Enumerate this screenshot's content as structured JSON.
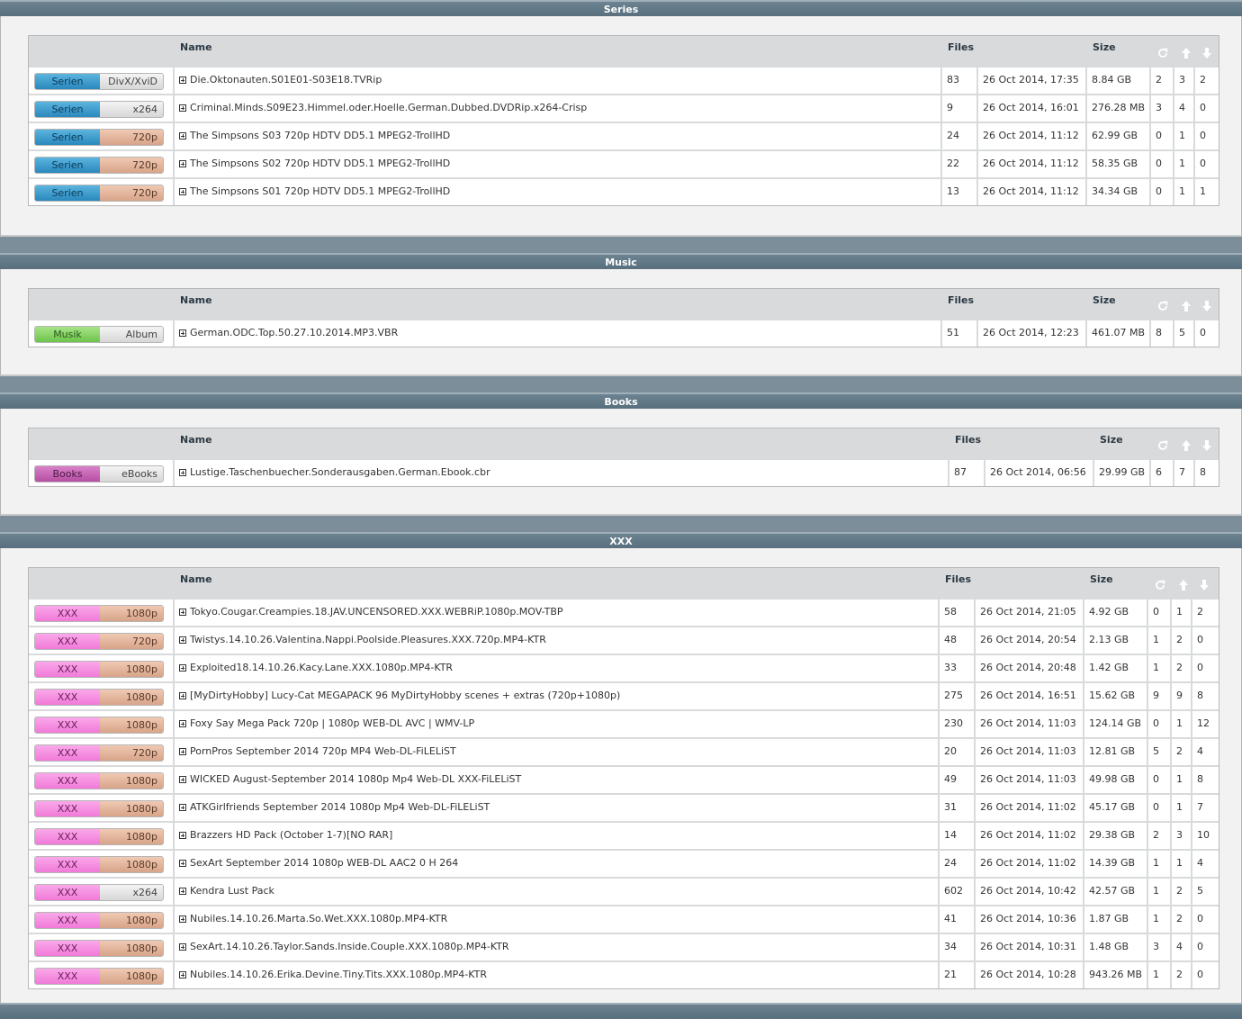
{
  "headers": {
    "name": "Name",
    "files": "Files",
    "size": "Size"
  },
  "icons": {
    "refresh": "refresh-icon",
    "up": "arrow-up-icon",
    "down": "arrow-down-icon",
    "expand": "plus-box-icon"
  },
  "sections": [
    {
      "title": "Series",
      "rows": [
        {
          "cat": "Serien",
          "sub": "DivX/XviD",
          "name": "Die.Oktonauten.S01E01-S03E18.TVRip",
          "files": "83",
          "date": "26 Oct 2014, 17:35",
          "size": "8.84 GB",
          "r": "2",
          "s": "3",
          "l": "2"
        },
        {
          "cat": "Serien",
          "sub": "x264",
          "name": "Criminal.Minds.S09E23.Himmel.oder.Hoelle.German.Dubbed.DVDRip.x264-Crisp",
          "files": "9",
          "date": "26 Oct 2014, 16:01",
          "size": "276.28 MB",
          "r": "3",
          "s": "4",
          "l": "0"
        },
        {
          "cat": "Serien",
          "sub": "720p",
          "name": "The Simpsons S03 720p HDTV DD5.1 MPEG2-TrollHD",
          "files": "24",
          "date": "26 Oct 2014, 11:12",
          "size": "62.99 GB",
          "r": "0",
          "s": "1",
          "l": "0"
        },
        {
          "cat": "Serien",
          "sub": "720p",
          "name": "The Simpsons S02 720p HDTV DD5.1 MPEG2-TrollHD",
          "files": "22",
          "date": "26 Oct 2014, 11:12",
          "size": "58.35 GB",
          "r": "0",
          "s": "1",
          "l": "0"
        },
        {
          "cat": "Serien",
          "sub": "720p",
          "name": "The Simpsons S01 720p HDTV DD5.1 MPEG2-TrollHD",
          "files": "13",
          "date": "26 Oct 2014, 11:12",
          "size": "34.34 GB",
          "r": "0",
          "s": "1",
          "l": "1"
        }
      ]
    },
    {
      "title": "Music",
      "rows": [
        {
          "cat": "Musik",
          "sub": "Album",
          "name": "German.ODC.Top.50.27.10.2014.MP3.VBR",
          "files": "51",
          "date": "26 Oct 2014, 12:23",
          "size": "461.07 MB",
          "r": "8",
          "s": "5",
          "l": "0"
        }
      ]
    },
    {
      "title": "Books",
      "rows": [
        {
          "cat": "Books",
          "sub": "eBooks",
          "name": "Lustige.Taschenbuecher.Sonderausgaben.German.Ebook.cbr",
          "files": "87",
          "date": "26 Oct 2014, 06:56",
          "size": "29.99 GB",
          "r": "6",
          "s": "7",
          "l": "8"
        }
      ]
    },
    {
      "title": "XXX",
      "rows": [
        {
          "cat": "XXX",
          "sub": "1080p",
          "name": "Tokyo.Cougar.Creampies.18.JAV.UNCENSORED.XXX.WEBRiP.1080p.MOV-TBP",
          "files": "58",
          "date": "26 Oct 2014, 21:05",
          "size": "4.92 GB",
          "r": "0",
          "s": "1",
          "l": "2"
        },
        {
          "cat": "XXX",
          "sub": "720p",
          "name": "Twistys.14.10.26.Valentina.Nappi.Poolside.Pleasures.XXX.720p.MP4-KTR",
          "files": "48",
          "date": "26 Oct 2014, 20:54",
          "size": "2.13 GB",
          "r": "1",
          "s": "2",
          "l": "0"
        },
        {
          "cat": "XXX",
          "sub": "1080p",
          "name": "Exploited18.14.10.26.Kacy.Lane.XXX.1080p.MP4-KTR",
          "files": "33",
          "date": "26 Oct 2014, 20:48",
          "size": "1.42 GB",
          "r": "1",
          "s": "2",
          "l": "0"
        },
        {
          "cat": "XXX",
          "sub": "1080p",
          "name": "[MyDirtyHobby] Lucy-Cat MEGAPACK 96 MyDirtyHobby scenes + extras (720p+1080p)",
          "files": "275",
          "date": "26 Oct 2014, 16:51",
          "size": "15.62 GB",
          "r": "9",
          "s": "9",
          "l": "8"
        },
        {
          "cat": "XXX",
          "sub": "1080p",
          "name": "Foxy Say Mega Pack 720p | 1080p WEB-DL AVC | WMV-LP",
          "files": "230",
          "date": "26 Oct 2014, 11:03",
          "size": "124.14 GB",
          "r": "0",
          "s": "1",
          "l": "12"
        },
        {
          "cat": "XXX",
          "sub": "720p",
          "name": "PornPros September 2014 720p MP4 Web-DL-FiLELiST",
          "files": "20",
          "date": "26 Oct 2014, 11:03",
          "size": "12.81 GB",
          "r": "5",
          "s": "2",
          "l": "4"
        },
        {
          "cat": "XXX",
          "sub": "1080p",
          "name": "WICKED August-September 2014 1080p Mp4 Web-DL XXX-FiLELiST",
          "files": "49",
          "date": "26 Oct 2014, 11:03",
          "size": "49.98 GB",
          "r": "0",
          "s": "1",
          "l": "8"
        },
        {
          "cat": "XXX",
          "sub": "1080p",
          "name": "ATKGirlfriends September 2014 1080p Mp4 Web-DL-FiLELiST",
          "files": "31",
          "date": "26 Oct 2014, 11:02",
          "size": "45.17 GB",
          "r": "0",
          "s": "1",
          "l": "7"
        },
        {
          "cat": "XXX",
          "sub": "1080p",
          "name": "Brazzers HD Pack (October 1-7)[NO RAR]",
          "files": "14",
          "date": "26 Oct 2014, 11:02",
          "size": "29.38 GB",
          "r": "2",
          "s": "3",
          "l": "10"
        },
        {
          "cat": "XXX",
          "sub": "1080p",
          "name": "SexArt September 2014 1080p WEB-DL AAC2 0 H 264",
          "files": "24",
          "date": "26 Oct 2014, 11:02",
          "size": "14.39 GB",
          "r": "1",
          "s": "1",
          "l": "4"
        },
        {
          "cat": "XXX",
          "sub": "x264",
          "name": "Kendra Lust Pack",
          "files": "602",
          "date": "26 Oct 2014, 10:42",
          "size": "42.57 GB",
          "r": "1",
          "s": "2",
          "l": "5"
        },
        {
          "cat": "XXX",
          "sub": "1080p",
          "name": "Nubiles.14.10.26.Marta.So.Wet.XXX.1080p.MP4-KTR",
          "files": "41",
          "date": "26 Oct 2014, 10:36",
          "size": "1.87 GB",
          "r": "1",
          "s": "2",
          "l": "0"
        },
        {
          "cat": "XXX",
          "sub": "1080p",
          "name": "SexArt.14.10.26.Taylor.Sands.Inside.Couple.XXX.1080p.MP4-KTR",
          "files": "34",
          "date": "26 Oct 2014, 10:31",
          "size": "1.48 GB",
          "r": "3",
          "s": "4",
          "l": "0"
        },
        {
          "cat": "XXX",
          "sub": "1080p",
          "name": "Nubiles.14.10.26.Erika.Devine.Tiny.Tits.XXX.1080p.MP4-KTR",
          "files": "21",
          "date": "26 Oct 2014, 10:28",
          "size": "943.26 MB",
          "r": "1",
          "s": "2",
          "l": "0"
        }
      ]
    }
  ]
}
